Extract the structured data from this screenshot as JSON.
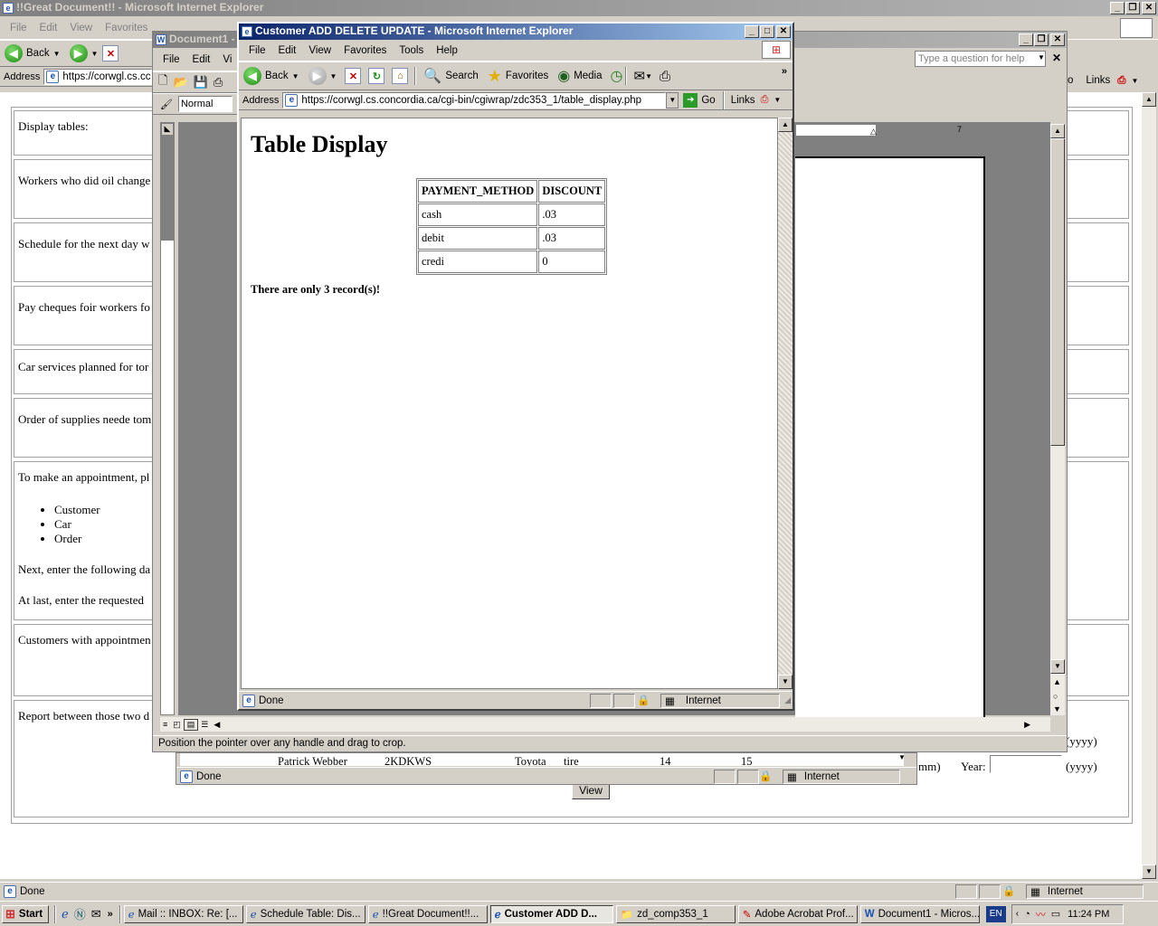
{
  "main_window": {
    "title": "!!Great Document!! - Microsoft Internet Explorer",
    "menu": [
      "File",
      "Edit",
      "View",
      "Favorites",
      "Tools",
      "Help"
    ],
    "back_label": "Back",
    "address_label": "Address",
    "address_value": "https://corwgl.cs.cc",
    "links_label": "Links",
    "go_partial": "o",
    "status": "Done",
    "zone": "Internet",
    "rows": [
      "Display tables:",
      "Workers who did oil change",
      "Schedule for the next day w",
      "Pay cheques foir workers fo",
      "Car services planned for tor",
      "Order of supplies neede tom",
      "To make an appointment, pl",
      "Customers with appointmen",
      "Report between those two d"
    ],
    "appointment_items": [
      "Customer",
      "Car",
      "Order"
    ],
    "next_text": "Next, enter the following da",
    "last_text": "At last, enter the requested",
    "yyyy1": "(yyyy)",
    "mm_text": "mm)",
    "year_label": "Year:",
    "yyyy2": "(yyyy)",
    "view_button": "View"
  },
  "word_window": {
    "title": "Document1 -",
    "menu": [
      "File",
      "Edit",
      "Vi"
    ],
    "style_value": "Normal",
    "help_placeholder": "Type a question for help",
    "status": "Position the pointer over any handle and drag to crop.",
    "ruler_number": "7"
  },
  "embedded_window": {
    "row_name": "Patrick Webber",
    "row_code": "2KDKWS",
    "row_make": "Toyota",
    "row_service": "tire",
    "row_a": "14",
    "row_b": "15",
    "status": "Done",
    "zone": "Internet"
  },
  "popup": {
    "title": "Customer ADD DELETE UPDATE - Microsoft Internet Explorer",
    "menu": [
      "File",
      "Edit",
      "View",
      "Favorites",
      "Tools",
      "Help"
    ],
    "toolbar": {
      "back": "Back",
      "search": "Search",
      "favorites": "Favorites",
      "media": "Media"
    },
    "address_label": "Address",
    "address_value": "https://corwgl.cs.concordia.ca/cgi-bin/cgiwrap/zdc353_1/table_display.php",
    "go_label": "Go",
    "links_label": "Links",
    "heading": "Table Display",
    "table": {
      "headers": [
        "PAYMENT_METHOD",
        "DISCOUNT"
      ],
      "rows": [
        [
          "cash",
          ".03"
        ],
        [
          "debit",
          ".03"
        ],
        [
          "credi",
          "0"
        ]
      ]
    },
    "record_text": "There are only 3 record(s)!",
    "status": "Done",
    "zone": "Internet"
  },
  "taskbar": {
    "start": "Start",
    "tasks": [
      {
        "label": "Mail :: INBOX: Re: [...",
        "pressed": false
      },
      {
        "label": "Schedule Table: Dis...",
        "pressed": false
      },
      {
        "label": "!!Great Document!!...",
        "pressed": false
      },
      {
        "label": "Customer ADD D...",
        "pressed": true
      },
      {
        "label": "zd_comp353_1",
        "pressed": false
      },
      {
        "label": "Adobe Acrobat Prof...",
        "pressed": false
      },
      {
        "label": "Document1 - Micros...",
        "pressed": false
      }
    ],
    "lang": "EN",
    "time": "11:24 PM"
  }
}
